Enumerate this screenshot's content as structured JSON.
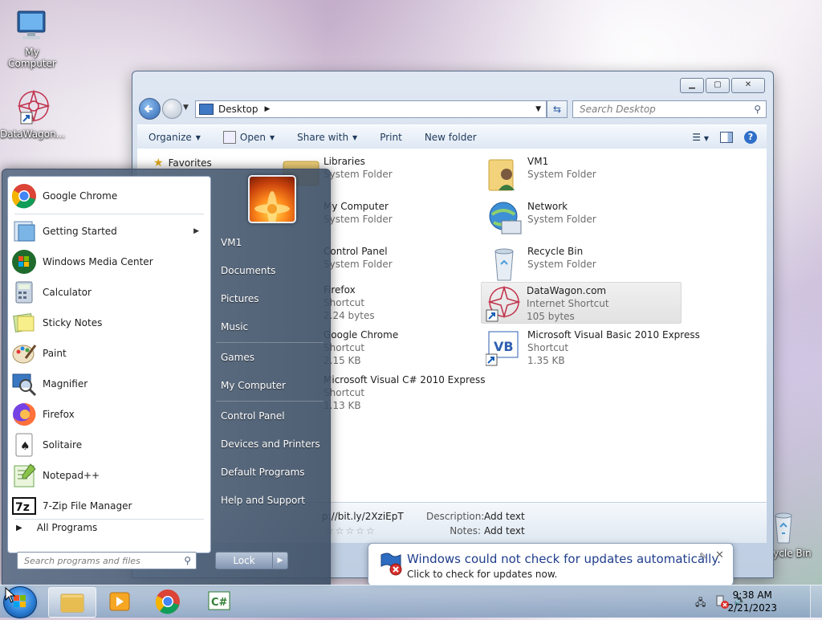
{
  "desktop": {
    "icons": [
      {
        "label": "My Computer"
      },
      {
        "label": "DataWagon..."
      },
      {
        "label": "Recycle Bin"
      }
    ]
  },
  "explorer": {
    "address": "Desktop",
    "search_placeholder": "Search Desktop",
    "toolbar": {
      "organize": "Organize",
      "open": "Open",
      "share_with": "Share with",
      "print": "Print",
      "new_folder": "New folder"
    },
    "nav": {
      "favorites": "Favorites"
    },
    "items": [
      {
        "name": "Libraries",
        "type": "System Folder"
      },
      {
        "name": "My Computer",
        "type": "System Folder"
      },
      {
        "name": "Control Panel",
        "type": "System Folder"
      },
      {
        "name": "Firefox",
        "type": "Shortcut",
        "size": "2.24 bytes"
      },
      {
        "name": "Google Chrome",
        "type": "Shortcut",
        "size": "2.15 KB"
      },
      {
        "name": "Microsoft Visual C# 2010 Express",
        "type": "Shortcut",
        "size": "1.13 KB"
      },
      {
        "name": "VM1",
        "type": "System Folder"
      },
      {
        "name": "Network",
        "type": "System Folder"
      },
      {
        "name": "Recycle Bin",
        "type": "System Folder"
      },
      {
        "name": "DataWagon.com",
        "type": "Internet Shortcut",
        "size": "105 bytes"
      },
      {
        "name": "Microsoft Visual Basic 2010 Express",
        "type": "Shortcut",
        "size": "1.35 KB"
      }
    ],
    "details": {
      "url": "p://bit.ly/2XziEpT",
      "description_label": "Description:",
      "description_value": "Add text",
      "notes_label": "Notes:",
      "notes_value": "Add text"
    }
  },
  "start_menu": {
    "programs": [
      {
        "label": "Google Chrome"
      },
      {
        "label": "Getting Started",
        "submenu": true
      },
      {
        "label": "Windows Media Center"
      },
      {
        "label": "Calculator"
      },
      {
        "label": "Sticky Notes"
      },
      {
        "label": "Paint"
      },
      {
        "label": "Magnifier"
      },
      {
        "label": "Firefox"
      },
      {
        "label": "Solitaire"
      },
      {
        "label": "Notepad++"
      },
      {
        "label": "7-Zip File Manager"
      }
    ],
    "all_programs": "All Programs",
    "search_placeholder": "Search programs and files",
    "right": {
      "user": "VM1",
      "documents": "Documents",
      "pictures": "Pictures",
      "music": "Music",
      "games": "Games",
      "my_computer": "My Computer",
      "control_panel": "Control Panel",
      "devices_printers": "Devices and Printers",
      "default_programs": "Default Programs",
      "help_support": "Help and Support"
    },
    "lock": "Lock"
  },
  "notification": {
    "title": "Windows could not check for updates automatically.",
    "subtitle": "Click to check for updates now."
  },
  "taskbar": {
    "time": "9:38 AM",
    "date": "2/21/2023"
  },
  "colors": {
    "accent": "#1f3d8c",
    "start_orb": "#2a7fd6"
  }
}
